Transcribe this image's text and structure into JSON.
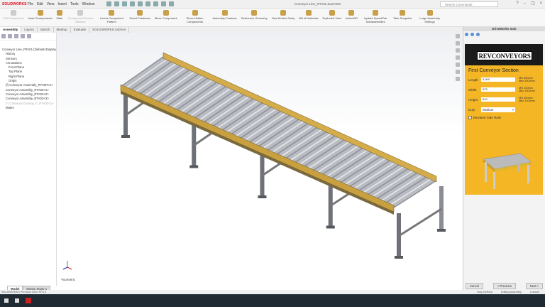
{
  "app": {
    "logo": "SOLIDWORKS",
    "menu": [
      "File",
      "Edit",
      "View",
      "Insert",
      "Tools",
      "Window"
    ],
    "doc_title": "Conveyor Line_RTA01.SLDASM",
    "search_placeholder": "Search Commands"
  },
  "commands": [
    {
      "label": "Edit Component",
      "disabled": true
    },
    {
      "label": "Insert Components"
    },
    {
      "label": "Mate"
    },
    {
      "label": "Component Preview Window",
      "disabled": true
    },
    {
      "label": "Linear Component Pattern"
    },
    {
      "label": "Smart Fasteners"
    },
    {
      "label": "Move Component"
    },
    {
      "label": "Show Hidden Components"
    },
    {
      "label": "Assembly Features"
    },
    {
      "label": "Reference Geometry"
    },
    {
      "label": "New Motion Study"
    },
    {
      "label": "Bill of Materials"
    },
    {
      "label": "Exploded View"
    },
    {
      "label": "Instant3D"
    },
    {
      "label": "Update SpeedPak Subassemblies"
    },
    {
      "label": "Take Snapshot"
    },
    {
      "label": "Large Assembly Settings"
    }
  ],
  "tabs": [
    "Assembly",
    "Layout",
    "Sketch",
    "Markup",
    "Evaluate",
    "SOLIDWORKS Add-Ins"
  ],
  "tree": {
    "items": [
      {
        "label": "Conveyor Line_RTA01 (Default<Display State-1>)",
        "cls": "root"
      },
      {
        "label": "History"
      },
      {
        "label": "Sensors"
      },
      {
        "label": "Annotations"
      },
      {
        "label": "Front Plane",
        "cls": "i1"
      },
      {
        "label": "Top Plane",
        "cls": "i1"
      },
      {
        "label": "Right Plane",
        "cls": "i1"
      },
      {
        "label": "Origin",
        "cls": "i1"
      },
      {
        "label": "(f) Conveyor Assembly_RTA0R<1>"
      },
      {
        "label": "Conveyor Assembly_RTA03<1>"
      },
      {
        "label": "Conveyor Assembly_RTA03<2>"
      },
      {
        "label": "Conveyor Assembly_RTA03<3>"
      },
      {
        "label": "(-) Conveyor Dummy_F_RTA02<1>",
        "cls": "sup"
      },
      {
        "label": "Mates"
      }
    ]
  },
  "viewport": {
    "view_label": "*Isometric"
  },
  "task_pane": {
    "title": "DriveWorks Solo",
    "brand": "REVCONVEYORS",
    "section_title": "First Conveyor Section",
    "fields": [
      {
        "label": "Length",
        "value": "3,000",
        "range": [
          "Min 600mm",
          "Max 3000mm"
        ]
      },
      {
        "label": "Width",
        "value": "875",
        "range": [
          "Min 400mm",
          "Max 1000mm"
        ]
      },
      {
        "label": "Height",
        "value": "640",
        "range": [
          "Min 600mm",
          "Max 1200mm"
        ]
      }
    ],
    "duty_label": "Duty",
    "duty_value": "Medium",
    "checkbox_label": "Elevated Side Rails",
    "checkbox_checked": true,
    "buttons": {
      "cancel": "Cancel",
      "previous": "< Previous",
      "next": "Next >"
    }
  },
  "bottom_tabs": [
    "Model",
    "Motion Study 1"
  ],
  "status": {
    "left": "SOLIDWORKS Premium 2020 SP4.0",
    "fully": "Fully Defined",
    "editing": "Editing Assembly",
    "units": "Custom"
  },
  "colors": {
    "brand": "#f5b625",
    "rail": "#c8a040"
  }
}
